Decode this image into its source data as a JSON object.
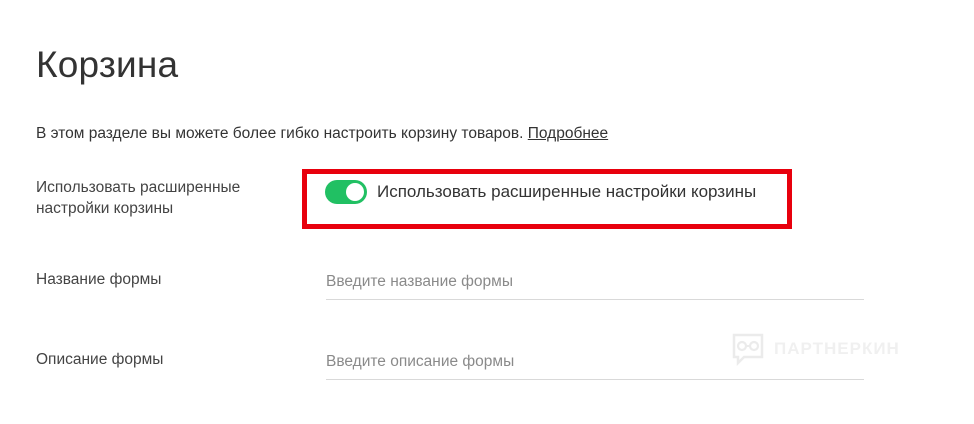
{
  "page": {
    "title": "Корзина",
    "intro_text": "В этом разделе вы можете более гибко настроить корзину товаров.",
    "intro_link": "Подробнее"
  },
  "extended_settings": {
    "label": "Использовать расширенные настройки корзины",
    "toggle_label": "Использовать расширенные настройки корзины",
    "enabled": true,
    "accent_color": "#21c063",
    "highlight_color": "#e8000d"
  },
  "form_name": {
    "label": "Название формы",
    "placeholder": "Введите название формы",
    "value": ""
  },
  "form_description": {
    "label": "Описание формы",
    "placeholder": "Введите описание формы",
    "value": ""
  },
  "watermark": {
    "text": "ПАРТНЕРКИН",
    "icon": "glasses-speech-bubble-icon"
  }
}
